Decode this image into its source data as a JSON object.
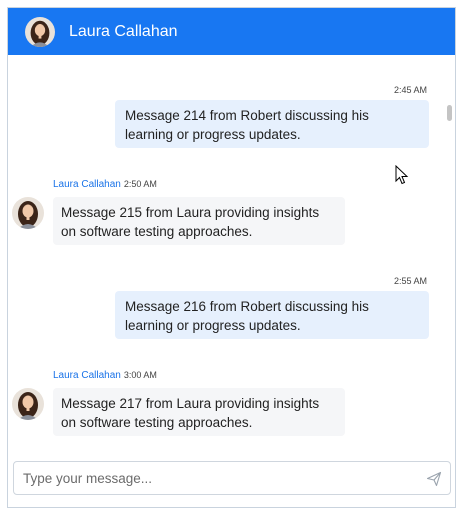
{
  "header": {
    "contact_name": "Laura Callahan",
    "avatar_icon": "user-avatar-icon"
  },
  "messages": [
    {
      "direction": "out",
      "time": "2:45 AM",
      "text": "Message 214 from Robert discussing his learning or progress updates."
    },
    {
      "direction": "in",
      "sender": "Laura Callahan",
      "time": "2:50 AM",
      "text": "Message 215 from Laura providing insights on software testing approaches."
    },
    {
      "direction": "out",
      "time": "2:55 AM",
      "text": "Message 216 from Robert discussing his learning or progress updates."
    },
    {
      "direction": "in",
      "sender": "Laura Callahan",
      "time": "3:00 AM",
      "text": "Message 217 from Laura providing insights on software testing approaches."
    }
  ],
  "composer": {
    "placeholder": "Type your message...",
    "send_icon": "send-icon"
  },
  "colors": {
    "header": "#1877f2",
    "outgoing_bubble": "#e6f0fd",
    "incoming_bubble": "#f5f6f8",
    "sender_name": "#1a73e8"
  }
}
